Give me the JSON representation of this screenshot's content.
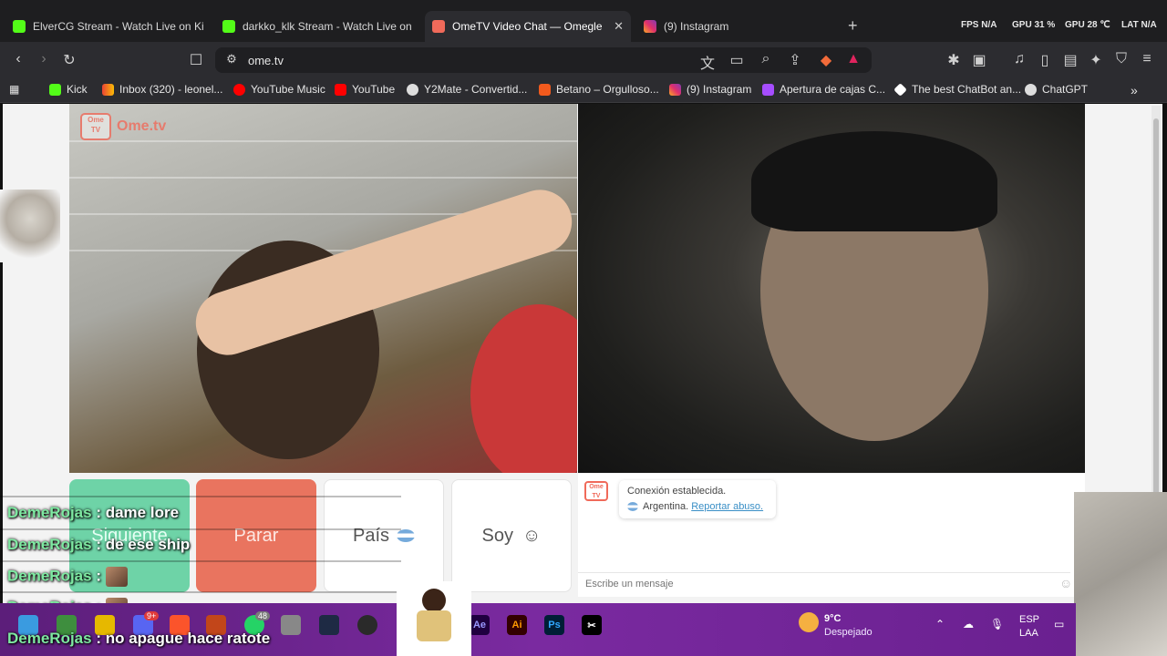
{
  "tabs": [
    {
      "title": "ElverCG Stream - Watch Live on Kick"
    },
    {
      "title": "darkko_klk Stream - Watch Live on Kick"
    },
    {
      "title": "OmeTV Video Chat — Omegle"
    },
    {
      "title": "(9) Instagram"
    }
  ],
  "perf": {
    "fps": "FPS  N/A",
    "gpu": "GPU  31 %",
    "gpu2": "GPU  28 ℃",
    "lat": "LAT  N/A"
  },
  "url": "ome.tv",
  "bookmarks": [
    "Kick",
    "Inbox (320) - leonel...",
    "YouTube Music",
    "YouTube",
    "Y2Mate - Convertid...",
    "Betano – Orgulloso...",
    "(9) Instagram",
    "Apertura de cajas C...",
    "The best ChatBot an...",
    "ChatGPT"
  ],
  "logo": {
    "badge": "Ome TV",
    "text": "Ome.tv"
  },
  "controls": {
    "next": "Siguiente",
    "stop": "Parar",
    "country": "País",
    "me": "Soy"
  },
  "system_message": {
    "line1": "Conexión establecida.",
    "country": "Argentina.",
    "report": "Reportar abuso."
  },
  "chat_input": {
    "placeholder": "Escribe un mensaje"
  },
  "overlay_chat": [
    {
      "user": "DemeRojas",
      "text": "dame lore"
    },
    {
      "user": "DemeRojas",
      "text": "de ese ship"
    },
    {
      "user": "DemeRojas",
      "text": ""
    },
    {
      "user": "DemeRojas",
      "text": ""
    },
    {
      "user": "DemeRojas",
      "text": "no apague hace ratote"
    }
  ],
  "taskbar": {
    "apps": [
      "Ae",
      "Ai",
      "Ps"
    ],
    "weather_temp": "9°C",
    "weather_desc": "Despejado",
    "lang": "ESP",
    "layout": "LAA",
    "badges": {
      "discord": "9+",
      "whatsapp": "48"
    }
  },
  "colors": {
    "next": "#6ed3a7",
    "stop": "#e9745f",
    "accent": "#f06a5a",
    "taskbar": "#6a2090"
  }
}
